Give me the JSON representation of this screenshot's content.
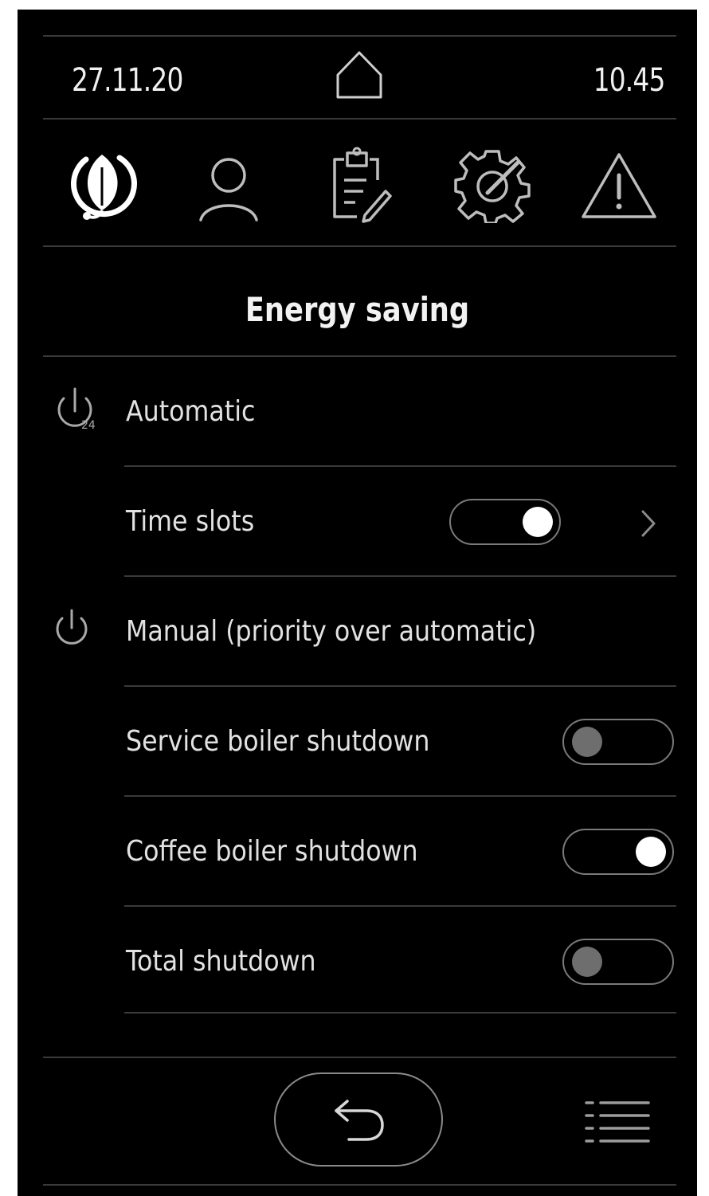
{
  "status_bar": {
    "date": "27.11.20",
    "time": "10.45",
    "home_icon": "home-icon"
  },
  "nav_icons": [
    {
      "name": "energy-saving-leaf-icon",
      "active": true
    },
    {
      "name": "user-icon",
      "active": false
    },
    {
      "name": "clipboard-edit-icon",
      "active": false
    },
    {
      "name": "gear-settings-icon",
      "active": false
    },
    {
      "name": "warning-icon",
      "active": false
    }
  ],
  "page": {
    "title": "Energy saving"
  },
  "sections": {
    "automatic": {
      "label": "Automatic",
      "icon": "power-24h-icon",
      "time_slots": {
        "label": "Time slots",
        "enabled": true
      }
    },
    "manual": {
      "label": "Manual (priority over automatic)",
      "icon": "power-icon",
      "items": [
        {
          "label": "Service boiler shutdown",
          "enabled": false
        },
        {
          "label": "Coffee boiler shutdown",
          "enabled": true
        },
        {
          "label": "Total shutdown",
          "enabled": false
        }
      ]
    }
  },
  "footer": {
    "back_icon": "back-arrow-icon",
    "menu_icon": "menu-list-icon"
  },
  "colors": {
    "background": "#000000",
    "text": "#e8e8e8",
    "divider": "#3a3a3a",
    "toggle_on": "#ffffff",
    "toggle_off": "#6e6e6e"
  }
}
